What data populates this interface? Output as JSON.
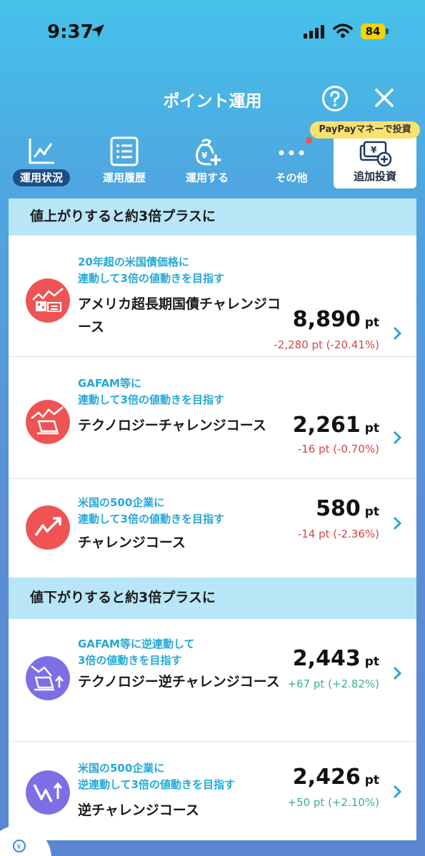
{
  "status_bar": {
    "time": "9:37",
    "battery": "84"
  },
  "header": {
    "title": "ポイント運用"
  },
  "tabs": [
    {
      "label": "運用状況",
      "icon": "chart-line-icon",
      "active": true
    },
    {
      "label": "運用履歴",
      "icon": "list-icon",
      "active": false
    },
    {
      "label": "運用する",
      "icon": "money-bag-plus-icon",
      "active": false
    },
    {
      "label": "その他",
      "icon": "more-dots-icon",
      "active": false
    }
  ],
  "add_invest": {
    "label": "追加投資",
    "badge": "PayPayマネーで投資",
    "icon": "bills-plus-icon"
  },
  "sections": [
    {
      "title": "値上がりすると約3倍プラスに",
      "items": [
        {
          "sub1": "20年超の米国債価格に",
          "sub2": "連動して3倍の値動きを目指す",
          "name": "アメリカ超長期国債チャレンジコース",
          "value": "8,890",
          "unit": "pt",
          "change": "-2,280 pt (-20.41%)",
          "direction": "down",
          "color": "#ef5354"
        },
        {
          "sub1": "GAFAM等に",
          "sub2": "連動して3倍の値動きを目指す",
          "name": "テクノロジーチャレンジコース",
          "value": "2,261",
          "unit": "pt",
          "change": "-16 pt (-0.70%)",
          "direction": "down",
          "color": "#ef5354"
        },
        {
          "sub1": "米国の500企業に",
          "sub2": "連動して3倍の値動きを目指す",
          "name": "チャレンジコース",
          "value": "580",
          "unit": "pt",
          "change": "-14 pt (-2.36%)",
          "direction": "down",
          "color": "#ef5354"
        }
      ]
    },
    {
      "title": "値下がりすると約3倍プラスに",
      "items": [
        {
          "sub1": "GAFAM等に逆連動して",
          "sub2": "3倍の値動きを目指す",
          "name": "テクノロジー逆チャレンジコース",
          "value": "2,443",
          "unit": "pt",
          "change": "+67 pt (+2.82%)",
          "direction": "up",
          "color": "#7c6fe6"
        },
        {
          "sub1": "米国の500企業に",
          "sub2": "逆連動して3倍の値動きを目指す",
          "name": "逆チャレンジコース",
          "value": "2,426",
          "unit": "pt",
          "change": "+50 pt (+2.10%)",
          "direction": "up",
          "color": "#7c6fe6"
        }
      ]
    }
  ]
}
